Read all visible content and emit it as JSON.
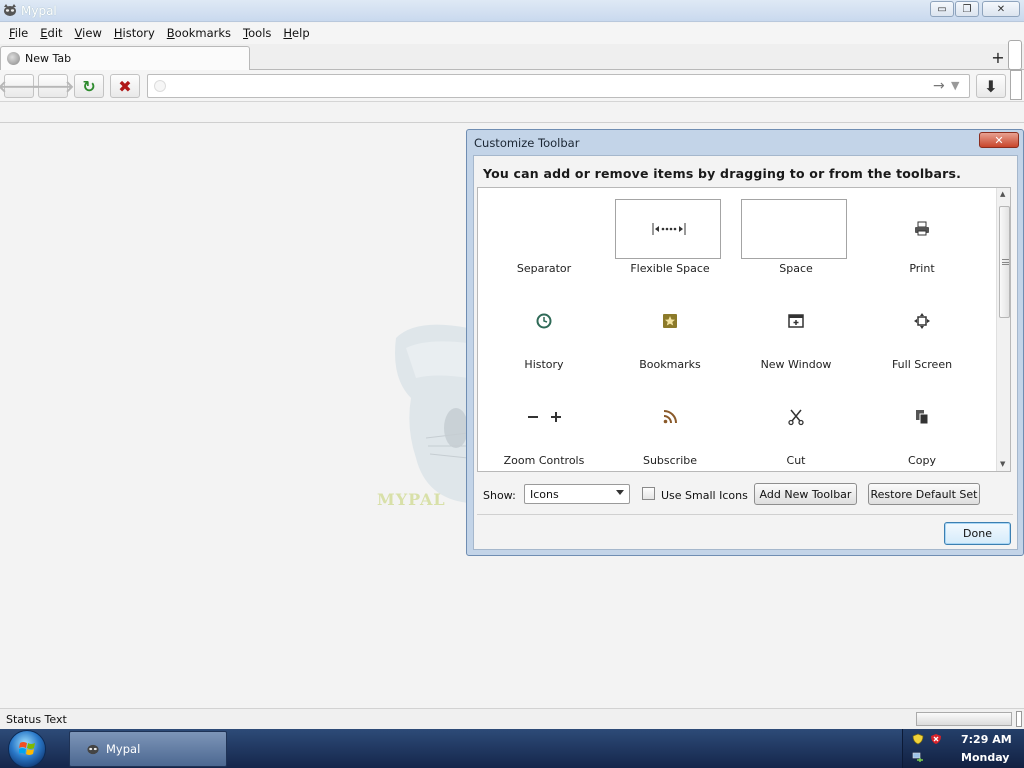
{
  "window": {
    "title": "Mypal",
    "minimize_glyph": "▭",
    "maximize_glyph": "❐",
    "close_glyph": "✕"
  },
  "menubar": {
    "items": [
      {
        "accel": "F",
        "rest": "ile"
      },
      {
        "accel": "E",
        "rest": "dit"
      },
      {
        "accel": "V",
        "rest": "iew"
      },
      {
        "accel": "H",
        "rest": "istory"
      },
      {
        "accel": "B",
        "rest": "ookmarks"
      },
      {
        "accel": "T",
        "rest": "ools"
      },
      {
        "accel": "H",
        "rest": "elp"
      }
    ]
  },
  "tabs": {
    "active_label": "New Tab",
    "new_tab_glyph": "+"
  },
  "navbar": {
    "back_glyph": "🡐",
    "forward_glyph": "🡒",
    "reload_glyph": "↻",
    "stop_glyph": "✖",
    "url_value": "",
    "go_glyph": "→",
    "dropdown_glyph": "▼",
    "download_glyph": "⬇"
  },
  "background": {
    "logo_text": "MYPAL"
  },
  "dialog": {
    "title": "Customize Toolbar",
    "close_glyph": "✕",
    "instructions": "You can add or remove items by dragging to or from the toolbars.",
    "palette_items": [
      {
        "label": "Separator",
        "icon": "separator"
      },
      {
        "label": "Flexible Space",
        "icon": "flexible-space"
      },
      {
        "label": "Space",
        "icon": "space"
      },
      {
        "label": "Print",
        "icon": "printer-icon"
      },
      {
        "label": "History",
        "icon": "clock-icon"
      },
      {
        "label": "Bookmarks",
        "icon": "bookmark-star-icon"
      },
      {
        "label": "New Window",
        "icon": "new-window-icon"
      },
      {
        "label": "Full Screen",
        "icon": "fullscreen-icon"
      },
      {
        "label": "Zoom Controls",
        "icon": "zoom-icons"
      },
      {
        "label": "Subscribe",
        "icon": "rss-icon"
      },
      {
        "label": "Cut",
        "icon": "scissors-icon"
      },
      {
        "label": "Copy",
        "icon": "copy-icon"
      }
    ],
    "show_label": "Show:",
    "show_value": "Icons",
    "small_icons_label": "Use Small Icons",
    "small_icons_checked": false,
    "add_toolbar_label": "Add New Toolbar",
    "restore_label": "Restore Default Set",
    "done_label": "Done"
  },
  "statusbar": {
    "text": "Status Text"
  },
  "taskbar": {
    "task_label": "Mypal",
    "time": "7:29 AM",
    "day": "Monday"
  },
  "colors": {
    "titlebar": "#c9d9ee",
    "dialog_frame": "#c3d4e8",
    "taskbar": "#1d3560",
    "accent_green": "#2e8b2e",
    "stop_red": "#b01818"
  }
}
